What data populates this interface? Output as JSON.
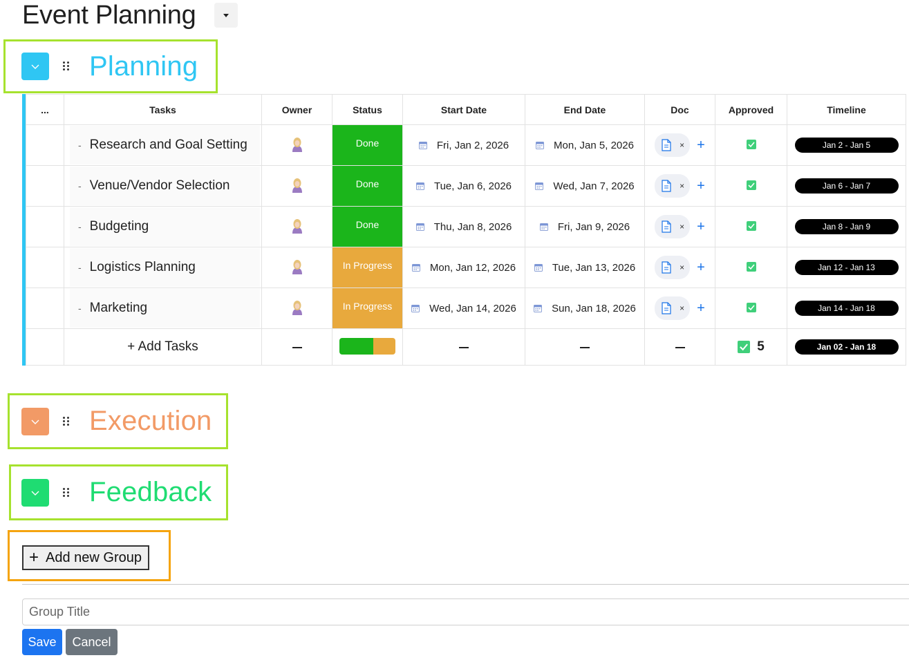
{
  "page": {
    "title": "Event Planning"
  },
  "groups": [
    {
      "title": "Planning",
      "color": "#2fc6f3"
    },
    {
      "title": "Execution",
      "color": "#f29a66"
    },
    {
      "title": "Feedback",
      "color": "#1fdc72"
    }
  ],
  "table": {
    "columns": [
      "...",
      "Tasks",
      "Owner",
      "Status",
      "Start Date",
      "End Date",
      "Doc",
      "Approved",
      "Timeline"
    ],
    "rows": [
      {
        "task": "Research and Goal Setting",
        "status": "Done",
        "status_color": "#1bb51b",
        "start": "Fri, Jan 2, 2026",
        "end": "Mon, Jan 5, 2026",
        "doc_remove": "×",
        "doc_add": "+",
        "approved": true,
        "timeline": "Jan 2 - Jan 5"
      },
      {
        "task": "Venue/Vendor Selection",
        "status": "Done",
        "status_color": "#1bb51b",
        "start": "Tue, Jan 6, 2026",
        "end": "Wed, Jan 7, 2026",
        "doc_remove": "×",
        "doc_add": "+",
        "approved": true,
        "timeline": "Jan 6 - Jan 7"
      },
      {
        "task": "Budgeting",
        "status": "Done",
        "status_color": "#1bb51b",
        "start": "Thu, Jan 8, 2026",
        "end": "Fri, Jan 9, 2026",
        "doc_remove": "×",
        "doc_add": "+",
        "approved": true,
        "timeline": "Jan 8 - Jan 9"
      },
      {
        "task": "Logistics Planning",
        "status": "In Progress",
        "status_color": "#e8a93d",
        "start": "Mon, Jan 12, 2026",
        "end": "Tue, Jan 13, 2026",
        "doc_remove": "×",
        "doc_add": "+",
        "approved": true,
        "timeline": "Jan 12 - Jan 13"
      },
      {
        "task": "Marketing",
        "status": "In Progress",
        "status_color": "#e8a93d",
        "start": "Wed, Jan 14, 2026",
        "end": "Sun, Jan 18, 2026",
        "doc_remove": "×",
        "doc_add": "+",
        "approved": true,
        "timeline": "Jan 14 - Jan 18"
      }
    ],
    "summary": {
      "add_tasks_label": "+ Add Tasks",
      "status_done_fraction": 0.6,
      "done_color": "#1bb51b",
      "progress_color": "#e8a93d",
      "approved_count": "5",
      "timeline": "Jan 02 - Jan 18"
    }
  },
  "add_group": {
    "label": "Add new Group"
  },
  "group_form": {
    "placeholder": "Group Title",
    "save_label": "Save",
    "cancel_label": "Cancel"
  }
}
